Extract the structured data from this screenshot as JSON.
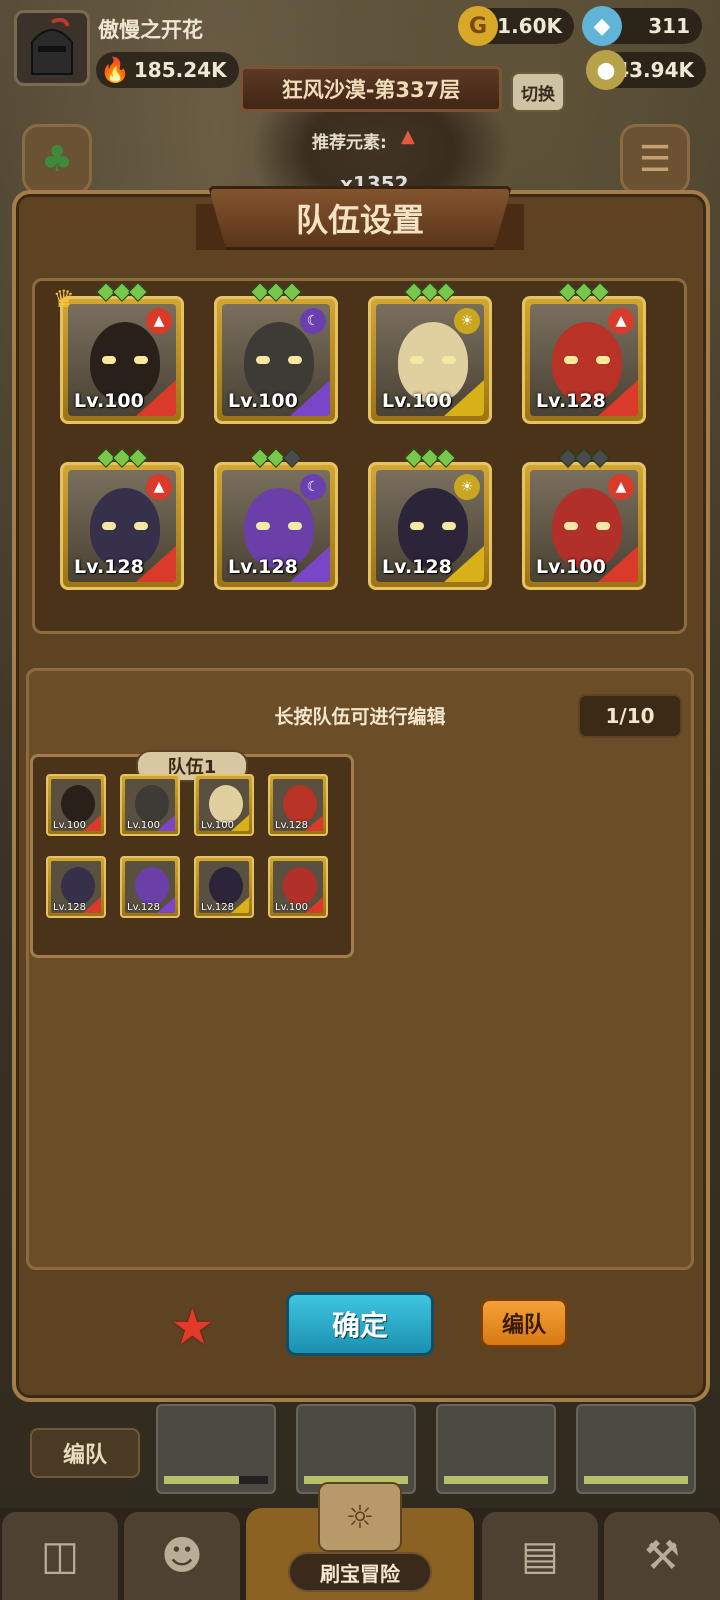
{
  "player": {
    "name": "傲慢之开花",
    "power": "185.24K"
  },
  "resources": {
    "gold": "31.60K",
    "gems": "311",
    "potion": "243.94K"
  },
  "stage": {
    "title": "狂风沙漠-第337层",
    "switch_label": "切换",
    "recommend_label": "推荐元素:",
    "count_text": "x1352"
  },
  "panel": {
    "title": "队伍设置",
    "edit_hint": "长按队伍可进行编辑",
    "team_count": "1/10",
    "team_name": "队伍1",
    "confirm_label": "确定",
    "formation_label": "编队"
  },
  "heroes": [
    {
      "level": "Lv.100",
      "element": "fire",
      "role_color": "#d93a2a",
      "stars": [
        1,
        1,
        1
      ],
      "crown": true,
      "skin": "#2a201a"
    },
    {
      "level": "Lv.100",
      "element": "moon",
      "role_color": "#7a46c8",
      "stars": [
        1,
        1,
        1
      ],
      "crown": false,
      "skin": "#3e3a36"
    },
    {
      "level": "Lv.100",
      "element": "sun",
      "role_color": "#d8b018",
      "stars": [
        1,
        1,
        1
      ],
      "crown": false,
      "skin": "#e0d0a0"
    },
    {
      "level": "Lv.128",
      "element": "fire",
      "role_color": "#d93a2a",
      "stars": [
        1,
        1,
        1
      ],
      "crown": false,
      "skin": "#b83226"
    },
    {
      "level": "Lv.128",
      "element": "fire",
      "role_color": "#d93a2a",
      "stars": [
        1,
        1,
        1
      ],
      "crown": false,
      "skin": "#36304a"
    },
    {
      "level": "Lv.128",
      "element": "moon",
      "role_color": "#7a46c8",
      "stars": [
        1,
        1,
        0
      ],
      "crown": false,
      "skin": "#6a3fa8"
    },
    {
      "level": "Lv.128",
      "element": "sun",
      "role_color": "#d8b018",
      "stars": [
        1,
        1,
        1
      ],
      "crown": false,
      "skin": "#2c2438"
    },
    {
      "level": "Lv.100",
      "element": "fire",
      "role_color": "#d93a2a",
      "stars": [
        0,
        0,
        0
      ],
      "crown": false,
      "skin": "#b2302a"
    }
  ],
  "bottom": {
    "formation_label": "编队",
    "center_nav_label": "刷宝冒险"
  },
  "colors": {
    "panel_bg": "#5d4322",
    "confirm_blue": "#2aa9cc",
    "formation_orange": "#e8881e"
  }
}
